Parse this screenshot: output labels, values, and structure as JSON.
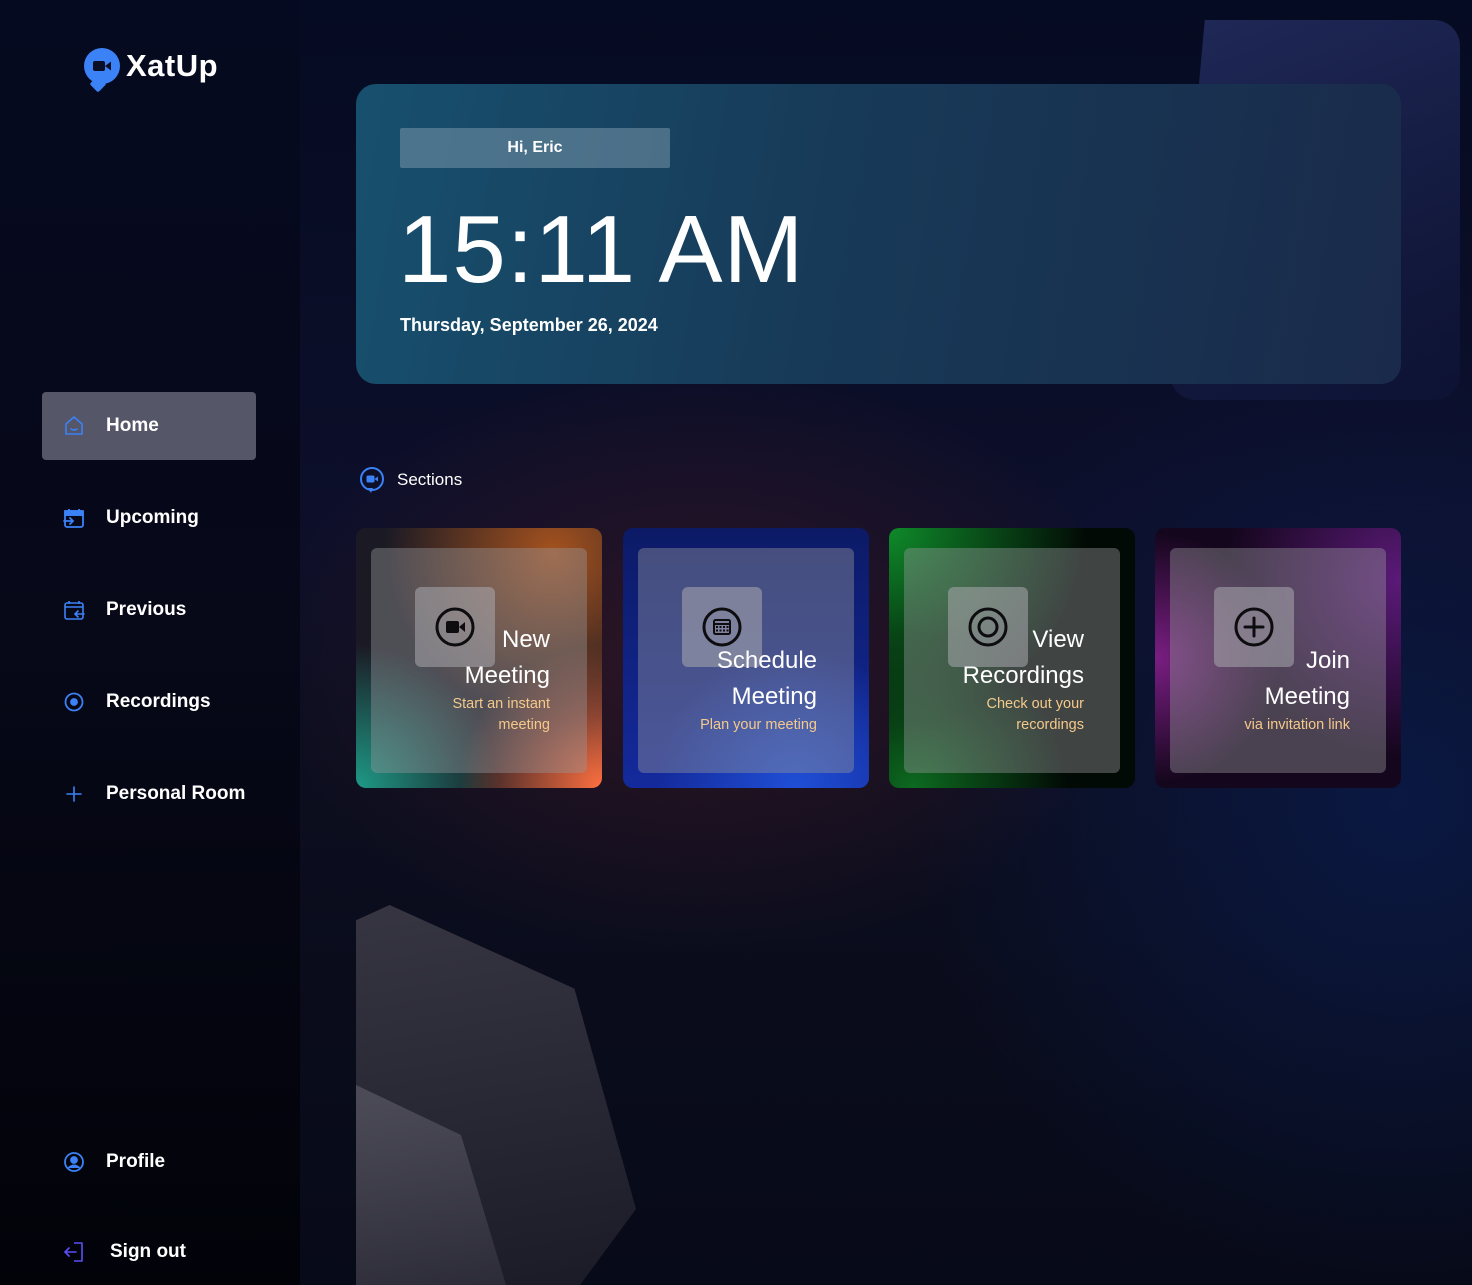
{
  "app": {
    "name": "XatUp",
    "brand_color": "#3b82f6"
  },
  "sidebar": {
    "items": [
      {
        "label": "Home",
        "icon": "home-icon",
        "active": true
      },
      {
        "label": "Upcoming",
        "icon": "calendar-upcoming-icon",
        "active": false
      },
      {
        "label": "Previous",
        "icon": "calendar-previous-icon",
        "active": false
      },
      {
        "label": "Recordings",
        "icon": "record-icon",
        "active": false
      },
      {
        "label": "Personal Room",
        "icon": "plus-icon",
        "active": false
      }
    ],
    "bottom": [
      {
        "label": "Profile",
        "icon": "user-circle-icon"
      },
      {
        "label": "Sign out",
        "icon": "sign-out-icon"
      }
    ]
  },
  "hero": {
    "greeting": "Hi, Eric",
    "time": "15:11 AM",
    "date": "Thursday, September 26, 2024"
  },
  "sections": {
    "label": "Sections",
    "cards": [
      {
        "title_line1": "New",
        "title_line2": "Meeting",
        "sub_line1": "Start an instant",
        "sub_line2": "meeting",
        "icon": "video-camera-icon"
      },
      {
        "title_line1": "Schedule",
        "title_line2": "Meeting",
        "sub_line1": "Plan your meeting",
        "sub_line2": "",
        "icon": "calendar-icon"
      },
      {
        "title_line1": "View",
        "title_line2": "Recordings",
        "sub_line1": "Check out your",
        "sub_line2": "recordings",
        "icon": "record-icon"
      },
      {
        "title_line1": "Join",
        "title_line2": "Meeting",
        "sub_line1": "via invitation link",
        "sub_line2": "",
        "icon": "plus-circle-icon"
      }
    ]
  }
}
